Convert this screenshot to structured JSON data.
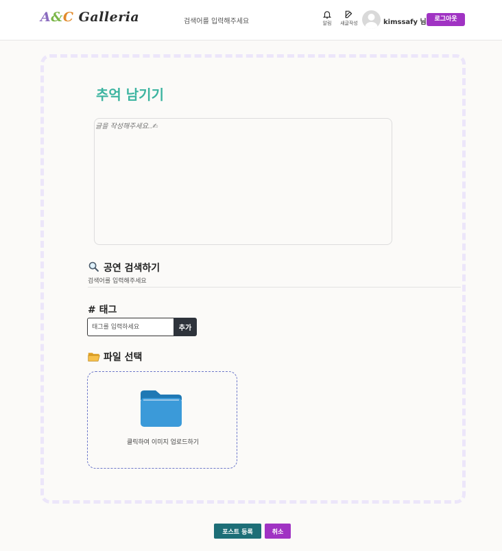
{
  "header": {
    "logo_text_1": "A",
    "logo_text_2": "&",
    "logo_text_3": "C",
    "logo_text_4": " Galleria",
    "search_placeholder": "검색어를 입력해주세요",
    "notifications_label": "알림",
    "write_label": "새글작성",
    "username": "kimssafy 님",
    "logout_label": "로그아웃"
  },
  "main": {
    "title": "추억 남기기",
    "post_placeholder": "글을 작성해주세요..✍",
    "show_search_title": "공연 검색하기",
    "show_search_placeholder": "검색어를 입력해주세요",
    "tag_title": "# 태그",
    "tag_placeholder": "태그를 입력하세요",
    "tag_add_label": "추가",
    "file_title": "파일 선택",
    "upload_label": "클릭하여 이미지 업로드하기"
  },
  "footer": {
    "submit_label": "포스트 등록",
    "cancel_label": "취소"
  },
  "colors": {
    "accent_purple": "#a033c3",
    "title_teal": "#3cb4a0",
    "submit_teal": "#1d6e77",
    "folder_blue": "#3b9ad9"
  },
  "icons": [
    "bell-icon",
    "edit-icon",
    "avatar-icon",
    "search-icon",
    "folder-open-icon",
    "folder-icon"
  ]
}
